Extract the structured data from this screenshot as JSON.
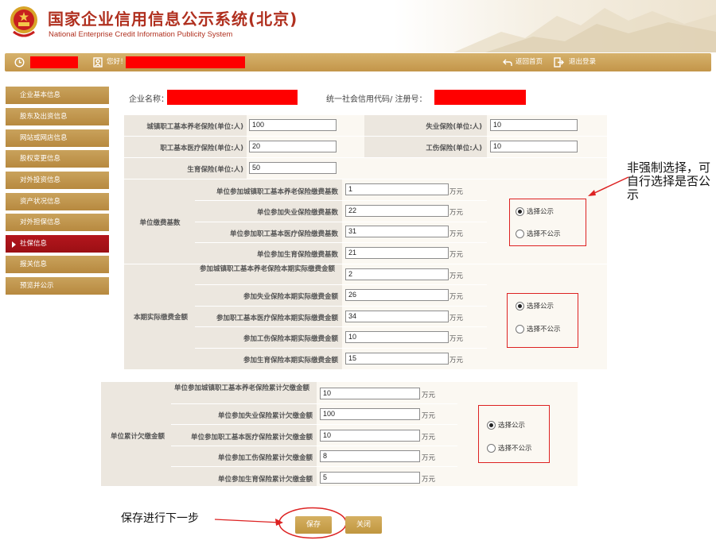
{
  "header": {
    "title": "国家企业信用信息公示系统(北京)",
    "subtitle": "National Enterprise Credit Information Publicity System"
  },
  "topbar": {
    "greeting": "您好！",
    "home_label": "返回首页",
    "logout_label": "退出登录"
  },
  "sidebar": {
    "items": [
      {
        "label": "企业基本信息"
      },
      {
        "label": "股东及出资信息"
      },
      {
        "label": "网站或网店信息"
      },
      {
        "label": "股权变更信息"
      },
      {
        "label": "对外投资信息"
      },
      {
        "label": "资产状况信息"
      },
      {
        "label": "对外担保信息"
      },
      {
        "label": "社保信息"
      },
      {
        "label": "报关信息"
      },
      {
        "label": "预览并公示"
      }
    ],
    "active_index": 7
  },
  "company": {
    "name_label": "企业名称：",
    "code_label": "统一社会信用代码/ 注册号："
  },
  "insured": {
    "pension_label": "城镇职工基本养老保险(单位:人)",
    "pension_value": "100",
    "unemployment_label": "失业保险(单位:人)",
    "unemployment_value": "10",
    "medical_label": "职工基本医疗保险(单位:人)",
    "medical_value": "20",
    "injury_label": "工伤保险(单位:人)",
    "injury_value": "10",
    "maternity_label": "生育保险(单位:人)",
    "maternity_value": "50"
  },
  "base": {
    "group_label": "单位缴费基数",
    "rows": [
      {
        "label": "单位参加城镇职工基本养老保险缴费基数",
        "value": "1",
        "unit": "万元"
      },
      {
        "label": "单位参加失业保险缴费基数",
        "value": "22",
        "unit": "万元"
      },
      {
        "label": "单位参加职工基本医疗保险缴费基数",
        "value": "31",
        "unit": "万元"
      },
      {
        "label": "单位参加生育保险缴费基数",
        "value": "21",
        "unit": "万元"
      }
    ],
    "publish_label": "选择公示",
    "unpublish_label": "选择不公示"
  },
  "actual": {
    "group_label": "本期实际缴费金额",
    "rows": [
      {
        "label": "参加城镇职工基本养老保险本期实际缴费金额",
        "value": "2",
        "unit": "万元"
      },
      {
        "label": "参加失业保险本期实际缴费金额",
        "value": "26",
        "unit": "万元"
      },
      {
        "label": "参加职工基本医疗保险本期实际缴费金额",
        "value": "34",
        "unit": "万元"
      },
      {
        "label": "参加工伤保险本期实际缴费金额",
        "value": "10",
        "unit": "万元"
      },
      {
        "label": "参加生育保险本期实际缴费金额",
        "value": "15",
        "unit": "万元"
      }
    ],
    "publish_label": "选择公示",
    "unpublish_label": "选择不公示"
  },
  "arrears": {
    "group_label": "单位累计欠缴金额",
    "rows": [
      {
        "label": "单位参加城镇职工基本养老保险累计欠缴金额",
        "value": "10",
        "unit": "万元"
      },
      {
        "label": "单位参加失业保险累计欠缴金额",
        "value": "100",
        "unit": "万元"
      },
      {
        "label": "单位参加职工基本医疗保险累计欠缴金额",
        "value": "10",
        "unit": "万元"
      },
      {
        "label": "单位参加工伤保险累计欠缴金额",
        "value": "8",
        "unit": "万元"
      },
      {
        "label": "单位参加生育保险累计欠缴金额",
        "value": "5",
        "unit": "万元"
      }
    ],
    "publish_label": "选择公示",
    "unpublish_label": "选择不公示"
  },
  "annotations": {
    "optional_note": "非强制选择，可自行选择是否公示",
    "save_note": "保存进行下一步"
  },
  "buttons": {
    "save_label": "保存",
    "close_label": "关闭"
  },
  "colors": {
    "gold": "#c9a25c",
    "active_red": "#b4161d",
    "title_red": "#b0301f",
    "annotation_red": "#dd2222"
  }
}
